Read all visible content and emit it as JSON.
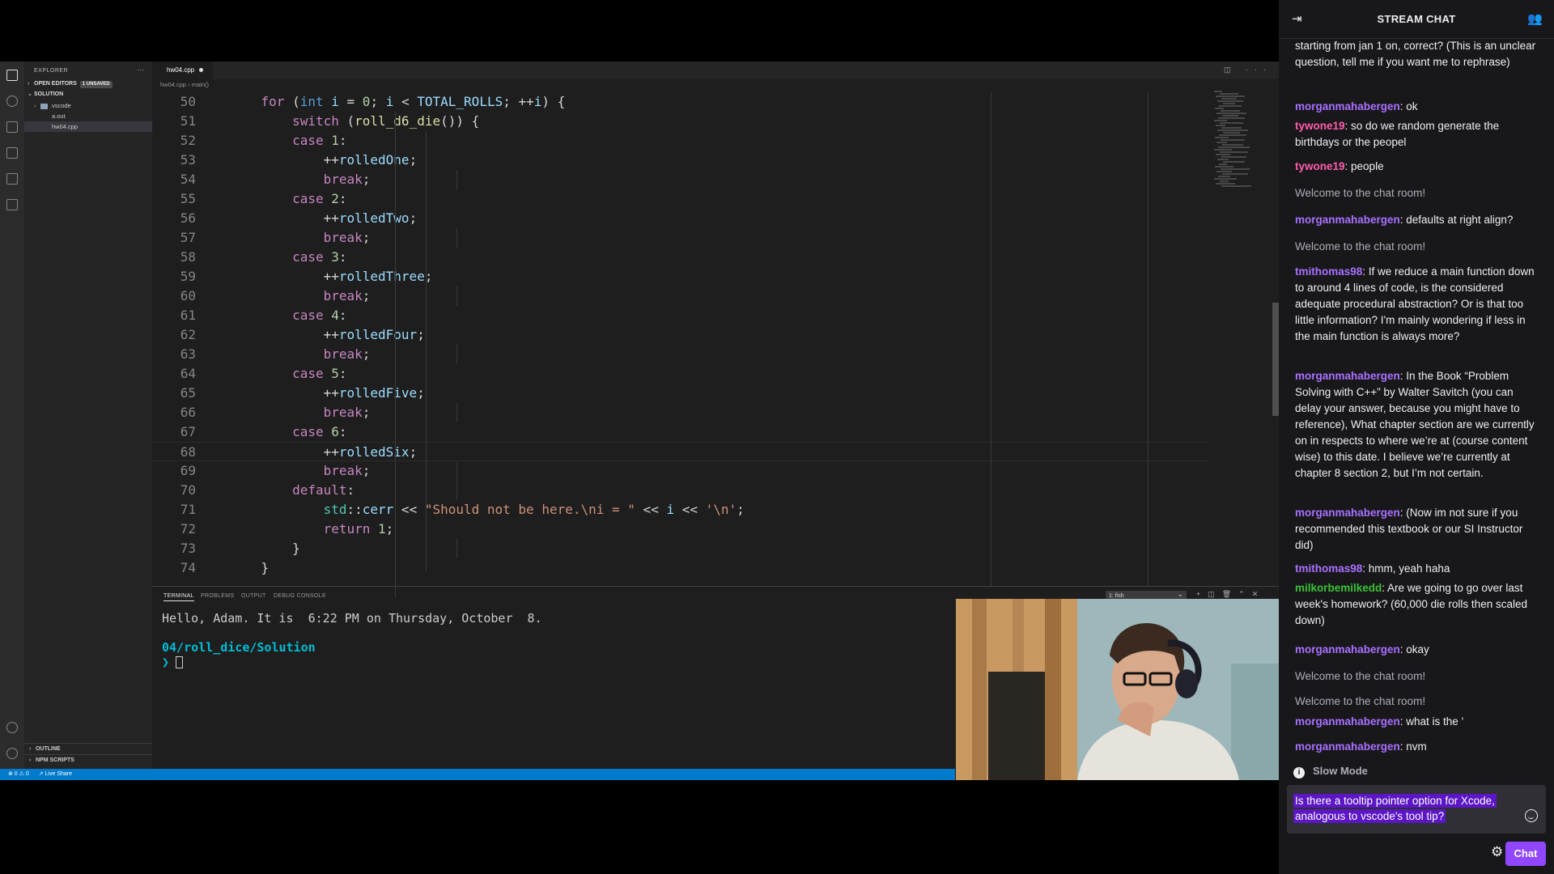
{
  "editor": {
    "sidebar": {
      "title": "EXPLORER",
      "open_editors": "OPEN EDITORS",
      "unsaved_badge": "1 UNSAVED",
      "folder": "SOLUTION",
      "items": [
        ".vscode",
        "a.out",
        "hw04.cpp"
      ],
      "outline": "OUTLINE",
      "npm_scripts": "NPM SCRIPTS"
    },
    "tab": {
      "label": "hw04.cpp"
    },
    "breadcrumb": {
      "file": "hw04.cpp",
      "symbol": "main()"
    },
    "panel": {
      "tabs": [
        "TERMINAL",
        "PROBLEMS",
        "OUTPUT",
        "DEBUG CONSOLE"
      ],
      "terminal_select": "1: fish",
      "greeting": "Hello, Adam. It is  6:22 PM on Thursday, October  8.",
      "cwd": "04/roll_dice/Solution",
      "prompt": "❯"
    },
    "status": {
      "errors": "⊗ 0 ⚠ 0",
      "live_share": "Live Share"
    }
  },
  "chat": {
    "title": "STREAM CHAT",
    "accent": "#9147ff",
    "messages": [
      {
        "user": "",
        "color": "",
        "text": "starting from jan 1 on, correct? (This is an unclear question, tell me if you want me to rephrase)"
      },
      {
        "user": "morganmahabergen",
        "color": "#a970ff",
        "text": ": ok"
      },
      {
        "user": "tywone19",
        "color": "#ff5cac",
        "text": ": so do we random generate the birthdays or the peopel"
      },
      {
        "user": "tywone19",
        "color": "#ff5cac",
        "text": ": people"
      },
      {
        "user": "",
        "color": "",
        "text": "Welcome to the chat room!",
        "system": true
      },
      {
        "user": "morganmahabergen",
        "color": "#a970ff",
        "text": ": defaults at right align?"
      },
      {
        "user": "",
        "color": "",
        "text": "Welcome to the chat room!",
        "system": true
      },
      {
        "user": "tmithomas98",
        "color": "#a970ff",
        "text": ": If we reduce a main function down to around 4 lines of code, is the considered adequate procedural abstraction? Or is that too little information? I'm mainly wondering if less in the main function is always more?"
      },
      {
        "user": "morganmahabergen",
        "color": "#a970ff",
        "text": ": In the Book “Problem Solving with C++” by Walter Savitch (you can delay your answer, because you might have to reference), What chapter section are we currently on in respects to where we’re at (course content wise) to this date. I believe we’re currently at chapter 8 section 2, but I’m not certain."
      },
      {
        "user": "morganmahabergen",
        "color": "#a970ff",
        "text": ": (Now im not sure if you recommended this textbook or our SI Instructor did)"
      },
      {
        "user": "tmithomas98",
        "color": "#a970ff",
        "text": ": hmm, yeah haha"
      },
      {
        "user": "milkorbemilkedd",
        "color": "#39c234",
        "text": ": Are we going to go over last week's homework? (60,000 die rolls then scaled down)"
      },
      {
        "user": "morganmahabergen",
        "color": "#a970ff",
        "text": ": okay"
      },
      {
        "user": "",
        "color": "",
        "text": "Welcome to the chat room!",
        "system": true
      },
      {
        "user": "",
        "color": "",
        "text": "Welcome to the chat room!",
        "system": true
      },
      {
        "user": "morganmahabergen",
        "color": "#a970ff",
        "text": ": what is the '"
      },
      {
        "user": "morganmahabergen",
        "color": "#a970ff",
        "text": ": nvm"
      }
    ],
    "slow_mode": "Slow Mode",
    "input_text": "Is there a tooltip pointer option for Xcode, analogous to vscode's tool tip?",
    "send_label": "Chat"
  }
}
